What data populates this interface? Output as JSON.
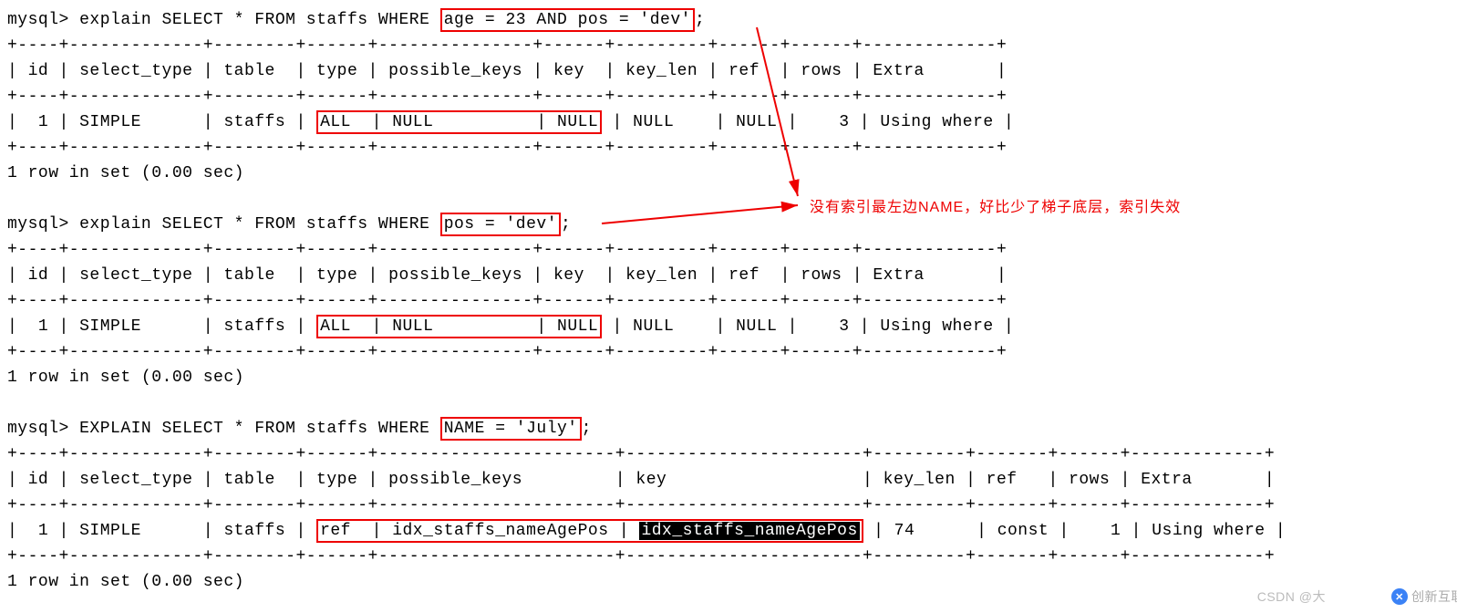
{
  "q1": {
    "prompt": "mysql> ",
    "pre": "explain SELECT * FROM staffs WHERE ",
    "box": "age = 23 AND pos = 'dev'",
    "post": ";",
    "sep_top": "+----+-------------+--------+------+---------------+------+---------+------+------+-------------+",
    "header": "| id | select_type | table  | type | possible_keys | key  | key_len | ref  | rows | Extra       |",
    "sep_mid": "+----+-------------+--------+------+---------------+------+---------+------+------+-------------+",
    "row_pre": "|  1 | SIMPLE      | staffs | ",
    "row_type": "ALL",
    "row_mid1": "  | ",
    "row_pk": "NULL",
    "row_mid2": "          | ",
    "row_key": "NULL",
    "row_post": " | NULL    | NULL |    3 | Using where |",
    "sep_bot": "+----+-------------+--------+------+---------------+------+---------+------+------+-------------+",
    "footer": "1 row in set (0.00 sec)"
  },
  "q2": {
    "prompt": "mysql> ",
    "pre": "explain SELECT * FROM staffs WHERE ",
    "box": "pos = 'dev'",
    "post": ";",
    "sep_top": "+----+-------------+--------+------+---------------+------+---------+------+------+-------------+",
    "header": "| id | select_type | table  | type | possible_keys | key  | key_len | ref  | rows | Extra       |",
    "sep_mid": "+----+-------------+--------+------+---------------+------+---------+------+------+-------------+",
    "row_pre": "|  1 | SIMPLE      | staffs | ",
    "row_type": "ALL",
    "row_mid1": "  | ",
    "row_pk": "NULL",
    "row_mid2": "          | ",
    "row_key": "NULL",
    "row_post": " | NULL    | NULL |    3 | Using where |",
    "sep_bot": "+----+-------------+--------+------+---------------+------+---------+------+------+-------------+",
    "footer": "1 row in set (0.00 sec)"
  },
  "q3": {
    "prompt": "mysql> ",
    "pre": "EXPLAIN SELECT * FROM staffs WHERE ",
    "box": "NAME = 'July'",
    "post": ";",
    "sep_top": "+----+-------------+--------+------+-----------------------+-----------------------+---------+-------+------+-------------+",
    "header": "| id | select_type | table  | type | possible_keys         | key                   | key_len | ref   | rows | Extra       |",
    "sep_mid": "+----+-------------+--------+------+-----------------------+-----------------------+---------+-------+------+-------------+",
    "row_pre": "|  1 | SIMPLE      | staffs | ",
    "row_type": "ref",
    "row_mid1": "  | ",
    "row_pk": "idx_staffs_nameAgePos",
    "row_mid2": " | ",
    "row_key": "idx_staffs_nameAgePos",
    "row_post": " | 74      | const |    1 | Using where |",
    "sep_bot": "+----+-------------+--------+------+-----------------------+-----------------------+---------+-------+------+-------------+",
    "footer": "1 row in set (0.00 sec)"
  },
  "annotation": "没有索引最左边NAME，好比少了梯子底层，索引失效",
  "watermark_csdn": "CSDN @大",
  "watermark_right": "创新互联"
}
